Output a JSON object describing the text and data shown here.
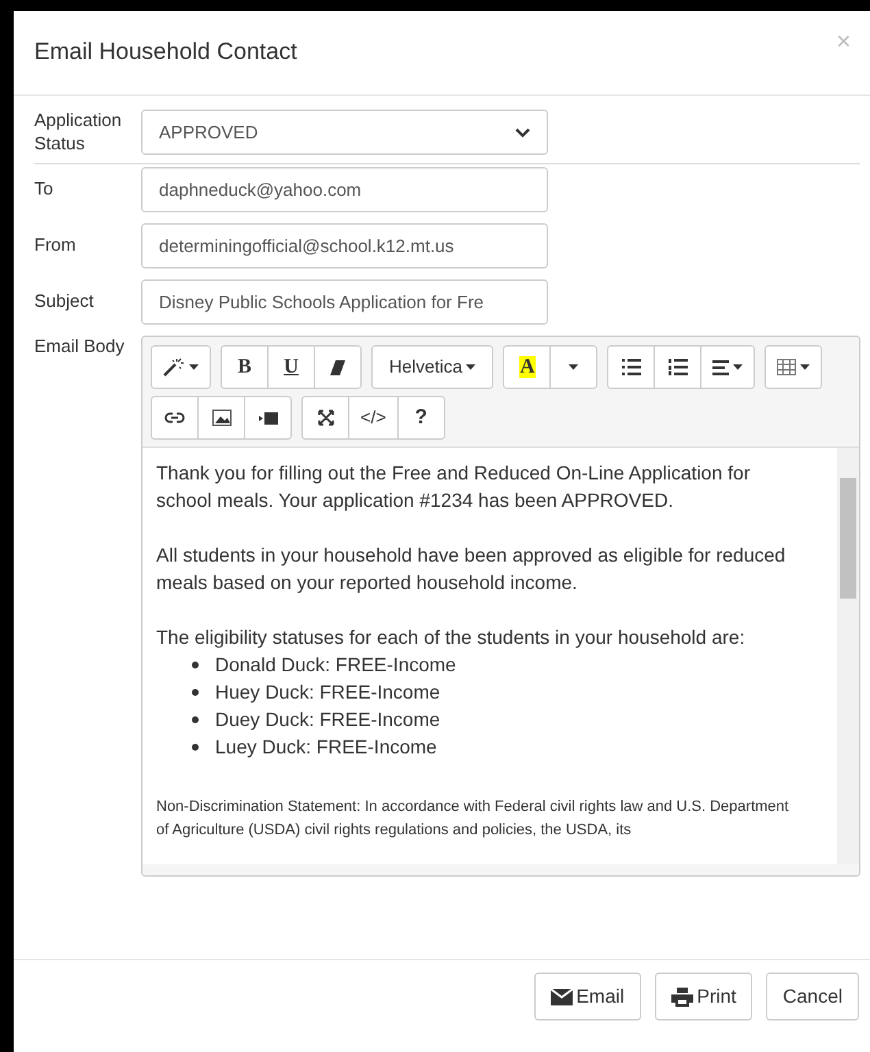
{
  "dialog": {
    "title": "Email Household Contact",
    "close": "×"
  },
  "fields": [
    {
      "kind": "select",
      "label": "Application Status",
      "value": "APPROVED"
    },
    {
      "kind": "text",
      "label": "To",
      "value": "daphneduck@yahoo.com"
    },
    {
      "kind": "text",
      "label": "From",
      "value": "determiningofficial@school.k12.mt.us"
    },
    {
      "kind": "text",
      "label": "Subject",
      "value": "Disney Public Schools Application for Fre"
    }
  ],
  "editor": {
    "label": "Email Body",
    "toolbar": [
      [
        [
          {
            "kind": "wand",
            "caret": true
          }
        ],
        [
          {
            "kind": "bold",
            "text": "B"
          },
          {
            "kind": "underline",
            "text": "U"
          },
          {
            "kind": "eraser"
          }
        ],
        [
          {
            "kind": "font",
            "text": "Helvetica",
            "caret": true
          }
        ],
        [
          {
            "kind": "highlight",
            "text": "A"
          },
          {
            "kind": "caret"
          }
        ],
        [
          {
            "kind": "ul"
          },
          {
            "kind": "ol"
          },
          {
            "kind": "align",
            "caret": true
          }
        ],
        [
          {
            "kind": "table",
            "caret": true
          }
        ]
      ],
      [
        [
          {
            "kind": "link"
          },
          {
            "kind": "image"
          },
          {
            "kind": "video"
          }
        ],
        [
          {
            "kind": "fullscreen"
          },
          {
            "kind": "code",
            "text": "</>"
          },
          {
            "kind": "help",
            "text": "?"
          }
        ]
      ]
    ],
    "body": [
      {
        "kind": "p",
        "text": "Thank you for filling out the Free and Reduced On-Line Application for school meals. Your application #1234 has been APPROVED."
      },
      {
        "kind": "p",
        "text": "All students in your household have been approved as eligible for reduced meals based on your reported household income."
      },
      {
        "kind": "p",
        "text": "The eligibility statuses for each of the students in your household are:"
      },
      {
        "kind": "list",
        "items": [
          "Donald Duck: FREE-Income",
          "Huey Duck: FREE-Income",
          "Duey Duck: FREE-Income",
          "Luey Duck: FREE-Income"
        ]
      },
      {
        "kind": "small",
        "text": "Non-Discrimination Statement: In accordance with Federal civil rights law and U.S. Department of Agriculture (USDA) civil rights regulations and policies, the USDA, its"
      }
    ]
  },
  "buttons": [
    {
      "kind": "email",
      "label": "Email"
    },
    {
      "kind": "print",
      "label": "Print"
    },
    {
      "kind": "cancel",
      "label": "Cancel"
    }
  ]
}
